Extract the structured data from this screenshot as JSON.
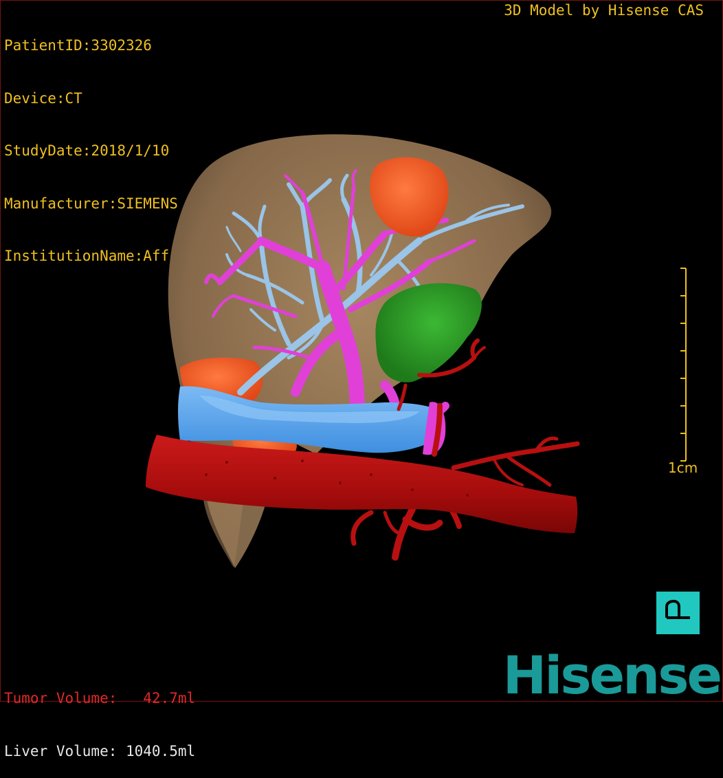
{
  "header": {
    "patient_id": "PatientID:3302326",
    "device": "Device:CT",
    "study_date": "StudyDate:2018/1/10",
    "manufacturer": "Manufacturer:SIEMENS",
    "institution": "InstitutionName:Affiliated Hospital Qingdao University-C",
    "model_credit": "3D Model by Hisense CAS"
  },
  "scale_bar": {
    "label": "1cm",
    "ticks": 8
  },
  "orientation": {
    "label": "P"
  },
  "volumes": {
    "tumor": "Tumor Volume:   42.7ml",
    "liver": "Liver Volume: 1040.5ml"
  },
  "brand": {
    "logo_text": "Hisense"
  },
  "colors": {
    "info_text": "#f0c020",
    "liver": "#8e6f4f",
    "tumor": "#f05a28",
    "portal_vein": "#e040d8",
    "hepatic_vein": "#9ac4e8",
    "ivc": "#5aa8f0",
    "artery": "#b81010",
    "gallbladder": "#2fa02a",
    "orient_button": "#20c8c0",
    "logo": "#1a9a98"
  }
}
